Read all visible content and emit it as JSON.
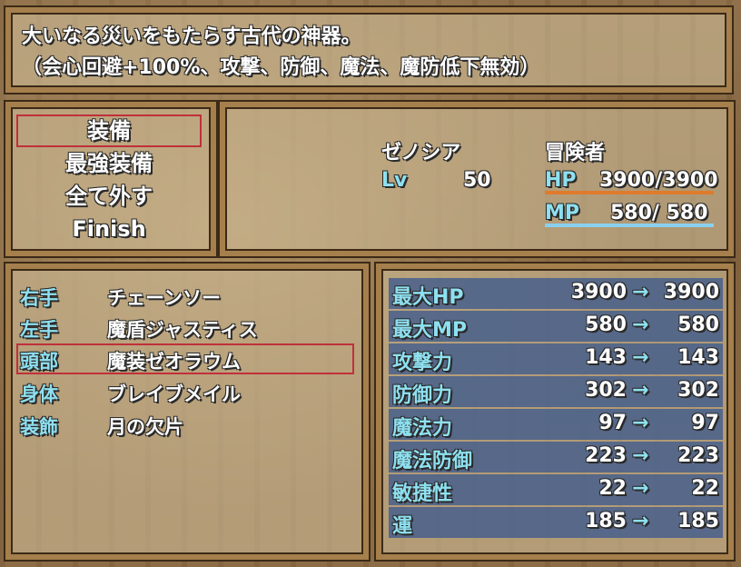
{
  "help": {
    "line1": "大いなる災いをもたらす古代の神器。",
    "line2": "（会心回避+100%、攻撃、防御、魔法、魔防低下無効）"
  },
  "commands": [
    "装備",
    "最強装備",
    "全て外す",
    "Finish"
  ],
  "actor": {
    "name": "ゼノシア",
    "class": "冒険者",
    "level_label": "Lv",
    "level": "50",
    "hp_label": "HP",
    "hp": "3900/3900",
    "mp_label": "MP",
    "mp": "580/ 580",
    "hp_fraction": 1.0,
    "mp_fraction": 1.0,
    "hp_color": "#e07a2c",
    "mp_color": "#8ad0f0"
  },
  "slots": [
    {
      "label": "右手",
      "item": "チェーンソー"
    },
    {
      "label": "左手",
      "item": "魔盾ジャスティス"
    },
    {
      "label": "頭部",
      "item": "魔装ゼオラウム"
    },
    {
      "label": "身体",
      "item": "ブレイブメイル"
    },
    {
      "label": "装飾",
      "item": "月の欠片"
    }
  ],
  "params": [
    {
      "name": "最大HP",
      "old": "3900",
      "new": "3900"
    },
    {
      "name": "最大MP",
      "old": "580",
      "new": "580"
    },
    {
      "name": "攻撃力",
      "old": "143",
      "new": "143"
    },
    {
      "name": "防御力",
      "old": "302",
      "new": "302"
    },
    {
      "name": "魔法力",
      "old": "97",
      "new": "97"
    },
    {
      "name": "魔法防御",
      "old": "223",
      "new": "223"
    },
    {
      "name": "敏捷性",
      "old": "22",
      "new": "22"
    },
    {
      "name": "運",
      "old": "185",
      "new": "185"
    }
  ],
  "arrow": "→",
  "selection_color": "#c0303a"
}
